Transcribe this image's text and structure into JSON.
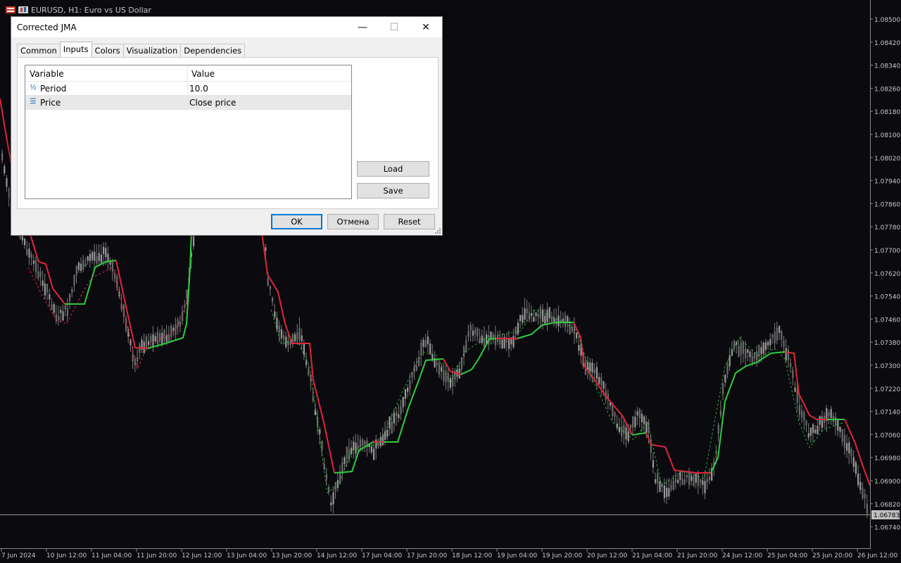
{
  "chart": {
    "title": "EURUSD, H1: Euro vs US Dollar",
    "bg_color": "#0b0b0f",
    "bull_color": "#2ecc40",
    "bear_color": "#e0243c",
    "candle_color": "#8a8a8a",
    "price_axis": [
      "1.08500",
      "1.08420",
      "1.08340",
      "1.08260",
      "1.08180",
      "1.08100",
      "1.08020",
      "1.07940",
      "1.07860",
      "1.07780",
      "1.07700",
      "1.07620",
      "1.07540",
      "1.07460",
      "1.07380",
      "1.07300",
      "1.07220",
      "1.07140",
      "1.07060",
      "1.06980",
      "1.06900",
      "1.06820",
      "1.06740"
    ],
    "current_price": "1.06783",
    "time_axis": [
      "7 Jun 2024",
      "10 Jun 12:00",
      "11 Jun 04:00",
      "11 Jun 20:00",
      "12 Jun 12:00",
      "13 Jun 04:00",
      "13 Jun 20:00",
      "14 Jun 12:00",
      "17 Jun 04:00",
      "17 Jun 20:00",
      "18 Jun 12:00",
      "19 Jun 04:00",
      "19 Jun 20:00",
      "20 Jun 12:00",
      "21 Jun 04:00",
      "21 Jun 20:00",
      "24 Jun 12:00",
      "25 Jun 04:00",
      "25 Jun 20:00",
      "26 Jun 12:00"
    ]
  },
  "dialog": {
    "title": "Corrected JMA",
    "minimize": "—",
    "maximize": "☐",
    "close": "✕",
    "tabs": [
      "Common",
      "Inputs",
      "Colors",
      "Visualization",
      "Dependencies"
    ],
    "active_tab": "Inputs",
    "columns": {
      "variable": "Variable",
      "value": "Value"
    },
    "rows": [
      {
        "icon": "½",
        "name": "Period",
        "value": "10.0"
      },
      {
        "icon": "☰",
        "name": "Price",
        "value": "Close price"
      }
    ],
    "load": "Load",
    "save": "Save",
    "ok": "OK",
    "cancel": "Отмена",
    "reset": "Reset"
  }
}
